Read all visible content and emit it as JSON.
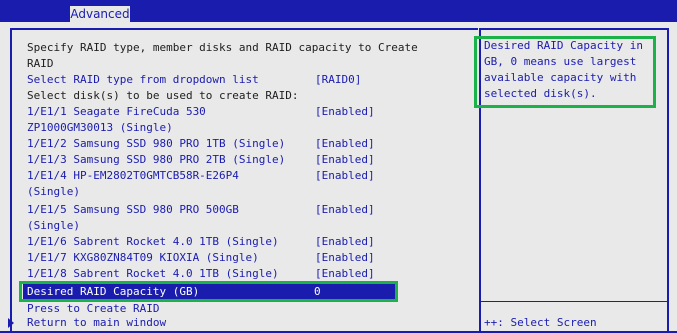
{
  "header": {
    "active_tab": "Advanced"
  },
  "main": {
    "intro": "Specify RAID type, member disks and RAID capacity to Create",
    "intro_cont": "RAID",
    "raid_type": {
      "label": "Select RAID type from dropdown list",
      "value": "[RAID0]"
    },
    "disks_heading": "Select disk(s) to be used to create RAID:",
    "disks": [
      {
        "line1": "1/E1/1 Seagate FireCuda 530",
        "line2": "ZP1000GM30013 (Single)",
        "value": "[Enabled]"
      },
      {
        "line1": "1/E1/2 Samsung SSD 980 PRO 1TB (Single)",
        "value": "[Enabled]"
      },
      {
        "line1": "1/E1/3 Samsung SSD 980 PRO 2TB (Single)",
        "value": "[Enabled]"
      },
      {
        "line1": "1/E1/4 HP-EM2802T0GMTCB58R-E26P4",
        "line2": "(Single)",
        "value": "[Enabled]"
      },
      {
        "line1": "1/E1/5 Samsung SSD 980 PRO 500GB",
        "line2": "(Single)",
        "value": "[Enabled]"
      },
      {
        "line1": "1/E1/6 Sabrent Rocket 4.0 1TB (Single)",
        "value": "[Enabled]"
      },
      {
        "line1": "1/E1/7 KXG80ZN84T09 KIOXIA (Single)",
        "value": "[Enabled]"
      },
      {
        "line1": "1/E1/8 Sabrent Rocket 4.0 1TB (Single)",
        "value": "[Enabled]"
      }
    ],
    "capacity": {
      "label": "Desired RAID Capacity (GB)",
      "value": "0"
    },
    "create_label": "Press to Create RAID",
    "return_label": "Return to main window"
  },
  "help": {
    "lines": [
      "Desired RAID Capacity in",
      "GB, 0 means use largest",
      "available capacity with",
      "selected disk(s)."
    ],
    "bottom_hint": "++: Select Screen"
  },
  "colors": {
    "background_blue": "#1a1cae",
    "panel_gray": "#e9e9e9",
    "callout_green": "#1bb24a"
  }
}
